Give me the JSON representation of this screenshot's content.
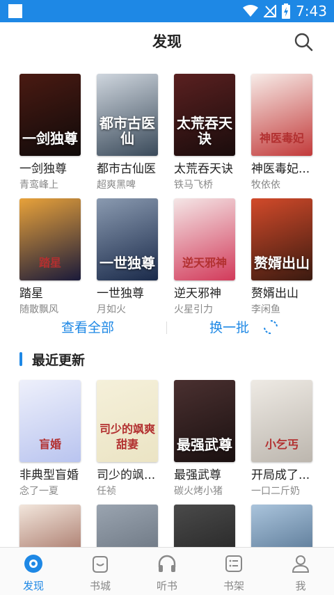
{
  "header": {
    "title": "发现"
  },
  "status": {
    "time": "7:43"
  },
  "featured": [
    {
      "title": "一剑独尊",
      "author": "青鸾峰上",
      "cover_text": "一剑独尊",
      "colors": [
        "#4a1a12",
        "#0f0a0a"
      ]
    },
    {
      "title": "都市古仙医",
      "author": "超爽黑啤",
      "cover_text": "都市古医仙",
      "colors": [
        "#cfd6de",
        "#3a4a5a"
      ]
    },
    {
      "title": "太荒吞天诀",
      "author": "铁马飞桥",
      "cover_text": "太荒吞天诀",
      "colors": [
        "#5a2020",
        "#1a0c0c"
      ]
    },
    {
      "title": "神医毒妃...",
      "author": "牧依依",
      "cover_text": "神医毒妃",
      "colors": [
        "#f7ece8",
        "#c23a3a"
      ]
    },
    {
      "title": "踏星",
      "author": "随散飘风",
      "cover_text": "踏星",
      "colors": [
        "#e8a23a",
        "#1a1a3a"
      ]
    },
    {
      "title": "一世独尊",
      "author": "月如火",
      "cover_text": "一世独尊",
      "colors": [
        "#8a9ab0",
        "#1a2a4a"
      ]
    },
    {
      "title": "逆天邪神",
      "author": "火星引力",
      "cover_text": "逆天邪神",
      "colors": [
        "#f4e6e6",
        "#d23a5a"
      ]
    },
    {
      "title": "赘婿出山",
      "author": "李闲鱼",
      "cover_text": "赘婿出山",
      "colors": [
        "#d24a2a",
        "#3a1a10"
      ]
    }
  ],
  "actions": {
    "view_all": "查看全部",
    "refresh": "换一批"
  },
  "recent": {
    "section_title": "最近更新",
    "books": [
      {
        "title": "非典型盲婚",
        "author": "念了一夏",
        "cover_text": "盲婚",
        "colors": [
          "#eef0fb",
          "#b9c4ef"
        ]
      },
      {
        "title": "司少的飒...",
        "author": "任祯",
        "cover_text": "司少的飒爽甜妻",
        "colors": [
          "#f5f0da",
          "#ebe4c4"
        ]
      },
      {
        "title": "最强武尊",
        "author": "碳火烤小猪",
        "cover_text": "最强武尊",
        "colors": [
          "#4a3030",
          "#1a1010"
        ]
      },
      {
        "title": "开局成了...",
        "author": "一口二斤奶",
        "cover_text": "小乞丐",
        "colors": [
          "#eeeae4",
          "#bcb6ae"
        ]
      },
      {
        "title": "",
        "author": "",
        "cover_text": "",
        "colors": [
          "#f2e6dc",
          "#8a4a3a"
        ]
      },
      {
        "title": "",
        "author": "",
        "cover_text": "",
        "colors": [
          "#9aa4b0",
          "#5a6470"
        ]
      },
      {
        "title": "",
        "author": "",
        "cover_text": "",
        "colors": [
          "#4a4a4a",
          "#1a1a1a"
        ]
      },
      {
        "title": "",
        "author": "",
        "cover_text": "",
        "colors": [
          "#aac4dc",
          "#3a5a7a"
        ]
      }
    ]
  },
  "tabs": [
    {
      "label": "发现",
      "icon": "compass-icon",
      "active": true
    },
    {
      "label": "书城",
      "icon": "bag-icon",
      "active": false
    },
    {
      "label": "听书",
      "icon": "headphones-icon",
      "active": false
    },
    {
      "label": "书架",
      "icon": "shelf-icon",
      "active": false
    },
    {
      "label": "我",
      "icon": "user-icon",
      "active": false
    }
  ],
  "colors": {
    "accent": "#1e88e5",
    "statusbar": "#1e88e5"
  }
}
